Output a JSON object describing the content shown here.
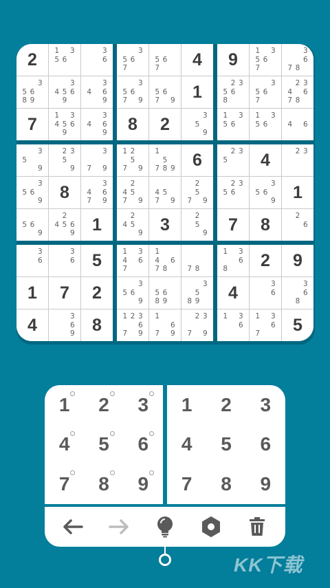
{
  "board": {
    "boxes": [
      [
        {
          "v": "2"
        },
        {
          "n": [
            "1",
            "",
            "3",
            "5",
            "6",
            "",
            "",
            "",
            ""
          ]
        },
        {
          "n": [
            "",
            "",
            "3",
            "",
            "",
            "6",
            "",
            "",
            ""
          ]
        },
        {
          "n": [
            "",
            "",
            "3",
            "5",
            "6",
            "",
            "8",
            "9",
            ""
          ]
        },
        {
          "n": [
            "",
            "",
            "3",
            "4",
            "5",
            "6",
            "",
            "9",
            ""
          ]
        },
        {
          "n": [
            "",
            "",
            "3",
            "4",
            "",
            "6",
            "",
            "",
            "9"
          ]
        },
        {
          "v": "7"
        },
        {
          "n": [
            "1",
            "",
            "3",
            "4",
            "5",
            "6",
            "",
            "9",
            ""
          ]
        },
        {
          "n": [
            "",
            "",
            "3",
            "4",
            "",
            "6",
            "",
            "",
            "9"
          ]
        }
      ],
      [
        {
          "n": [
            "",
            "",
            "3",
            "5",
            "6",
            "",
            "7",
            "",
            ""
          ]
        },
        {
          "n": [
            "",
            "",
            "",
            "5",
            "6",
            "",
            "7",
            "",
            ""
          ]
        },
        {
          "v": "4"
        },
        {
          "n": [
            "",
            "",
            "3",
            "5",
            "6",
            "",
            "7",
            "",
            "9"
          ]
        },
        {
          "n": [
            "",
            "",
            "",
            "5",
            "6",
            "",
            "7",
            "",
            "9"
          ]
        },
        {
          "v": "1"
        },
        {
          "v": "8"
        },
        {
          "v": "2"
        },
        {
          "n": [
            "",
            "",
            "3",
            "",
            "5",
            "",
            "",
            "",
            "9"
          ]
        }
      ],
      [
        {
          "v": "9"
        },
        {
          "n": [
            "1",
            "",
            "3",
            "5",
            "6",
            "",
            "7",
            "",
            ""
          ]
        },
        {
          "n": [
            "",
            "",
            "3",
            "",
            "",
            "6",
            "7",
            "8",
            ""
          ]
        },
        {
          "n": [
            "",
            "2",
            "3",
            "5",
            "6",
            "",
            "8",
            "",
            ""
          ]
        },
        {
          "n": [
            "",
            "",
            "3",
            "5",
            "6",
            "",
            "7",
            "",
            ""
          ]
        },
        {
          "n": [
            "",
            "2",
            "3",
            "4",
            "",
            "6",
            "7",
            "8",
            ""
          ]
        },
        {
          "n": [
            "1",
            "",
            "3",
            "5",
            "6",
            "",
            "",
            "",
            ""
          ]
        },
        {
          "n": [
            "1",
            "",
            "3",
            "5",
            "6",
            "",
            "",
            "",
            ""
          ]
        },
        {
          "n": [
            "",
            "",
            "",
            "4",
            "",
            "6",
            "",
            "",
            ""
          ]
        }
      ],
      [
        {
          "n": [
            "",
            "",
            "3",
            "5",
            "",
            "",
            "",
            "",
            "9"
          ]
        },
        {
          "n": [
            "",
            "2",
            "3",
            "",
            "5",
            "",
            "",
            "",
            "9"
          ]
        },
        {
          "n": [
            "",
            "",
            "3",
            "",
            "",
            "",
            "7",
            "",
            "9"
          ]
        },
        {
          "n": [
            "",
            "",
            "3",
            "5",
            "6",
            "",
            "",
            "",
            "9"
          ]
        },
        {
          "v": "8"
        },
        {
          "n": [
            "",
            "",
            "3",
            "4",
            "",
            "6",
            "7",
            "",
            "9"
          ]
        },
        {
          "n": [
            "",
            "",
            "",
            "5",
            "6",
            "",
            "",
            "",
            "9"
          ]
        },
        {
          "n": [
            "",
            "2",
            "",
            "4",
            "5",
            "6",
            "",
            "",
            "9"
          ]
        },
        {
          "v": "1"
        }
      ],
      [
        {
          "n": [
            "1",
            "2",
            "",
            "",
            "5",
            "",
            "7",
            "",
            "9"
          ]
        },
        {
          "n": [
            "1",
            "",
            "",
            "",
            "5",
            "",
            "7",
            "8",
            "9"
          ]
        },
        {
          "v": "6"
        },
        {
          "n": [
            "",
            "2",
            "",
            "4",
            "5",
            "",
            "7",
            "",
            "9"
          ]
        },
        {
          "n": [
            "",
            "",
            "",
            "4",
            "5",
            "",
            "7",
            "",
            "9"
          ]
        },
        {
          "n": [
            "",
            "2",
            "",
            "",
            "5",
            "",
            "7",
            "",
            "9"
          ]
        },
        {
          "n": [
            "",
            "2",
            "",
            "4",
            "5",
            "",
            "",
            "",
            "9"
          ]
        },
        {
          "v": "3"
        },
        {
          "n": [
            "",
            "2",
            "",
            "",
            "5",
            "",
            "",
            "",
            "9"
          ]
        }
      ],
      [
        {
          "n": [
            "",
            "2",
            "3",
            "5",
            "",
            "",
            "",
            "",
            ""
          ]
        },
        {
          "v": "4"
        },
        {
          "n": [
            "",
            "2",
            "3",
            "",
            "",
            "",
            "",
            "",
            ""
          ]
        },
        {
          "n": [
            "",
            "2",
            "3",
            "5",
            "6",
            "",
            "",
            "",
            ""
          ]
        },
        {
          "n": [
            "",
            "",
            "3",
            "5",
            "6",
            "",
            "",
            "",
            "9"
          ]
        },
        {
          "v": "1"
        },
        {
          "v": "7"
        },
        {
          "v": "8"
        },
        {
          "n": [
            "",
            "2",
            "",
            "",
            "",
            "6",
            "",
            "",
            ""
          ]
        }
      ],
      [
        {
          "n": [
            "",
            "",
            "3",
            "",
            "",
            "6",
            "",
            "",
            ""
          ]
        },
        {
          "n": [
            "",
            "",
            "3",
            "",
            "",
            "6",
            "",
            "",
            ""
          ]
        },
        {
          "v": "5"
        },
        {
          "v": "1"
        },
        {
          "v": "7"
        },
        {
          "v": "2"
        },
        {
          "v": "4"
        },
        {
          "n": [
            "",
            "",
            "3",
            "",
            "",
            "6",
            "",
            "",
            "9"
          ]
        },
        {
          "v": "8"
        }
      ],
      [
        {
          "n": [
            "1",
            "",
            "3",
            "4",
            "",
            "6",
            "7",
            "",
            ""
          ]
        },
        {
          "n": [
            "1",
            "",
            "",
            "4",
            "",
            "6",
            "7",
            "8",
            ""
          ]
        },
        {
          "n": [
            "",
            "",
            "",
            "",
            "",
            "",
            "7",
            "8",
            ""
          ]
        },
        {
          "n": [
            "",
            "",
            "3",
            "5",
            "6",
            "",
            "",
            "",
            "9"
          ]
        },
        {
          "n": [
            "",
            "",
            "",
            "5",
            "6",
            "",
            "8",
            "9",
            ""
          ]
        },
        {
          "n": [
            "",
            "",
            "3",
            "",
            "5",
            "",
            "8",
            "9",
            ""
          ]
        },
        {
          "n": [
            "1",
            "2",
            "3",
            "",
            "",
            "6",
            "7",
            "",
            "9"
          ]
        },
        {
          "n": [
            "1",
            "",
            "",
            "",
            "",
            "6",
            "7",
            "",
            "9"
          ]
        },
        {
          "n": [
            "",
            "2",
            "3",
            "",
            "",
            "",
            "7",
            "",
            "9"
          ]
        }
      ],
      [
        {
          "n": [
            "1",
            "",
            "3",
            "",
            "",
            "6",
            "8",
            "",
            ""
          ]
        },
        {
          "v": "2"
        },
        {
          "v": "9"
        },
        {
          "v": "4"
        },
        {
          "n": [
            "",
            "",
            "3",
            "",
            "",
            "6",
            "",
            "",
            ""
          ]
        },
        {
          "n": [
            "",
            "",
            "3",
            "",
            "",
            "6",
            "",
            "8",
            ""
          ]
        },
        {
          "n": [
            "1",
            "",
            "3",
            "",
            "",
            "6",
            "",
            "",
            ""
          ]
        },
        {
          "n": [
            "1",
            "",
            "3",
            "",
            "",
            "6",
            "7",
            "",
            ""
          ]
        },
        {
          "v": "5"
        }
      ]
    ]
  },
  "pencil_pad": {
    "keys": [
      "1",
      "2",
      "3",
      "4",
      "5",
      "6",
      "7",
      "8",
      "9"
    ]
  },
  "number_pad": {
    "keys": [
      "1",
      "2",
      "3",
      "4",
      "5",
      "6",
      "7",
      "8",
      "9"
    ]
  },
  "toolbar": {
    "icons": [
      "undo-arrow-icon",
      "redo-arrow-icon",
      "hint-bulb-icon",
      "settings-gear-icon",
      "trash-icon"
    ]
  },
  "watermark": {
    "text": "KK下载"
  },
  "colors": {
    "background": "#037e9b",
    "digit": "#3d3d3d",
    "note": "#5f5f5f",
    "redo_disabled": "#bdbdbd"
  }
}
